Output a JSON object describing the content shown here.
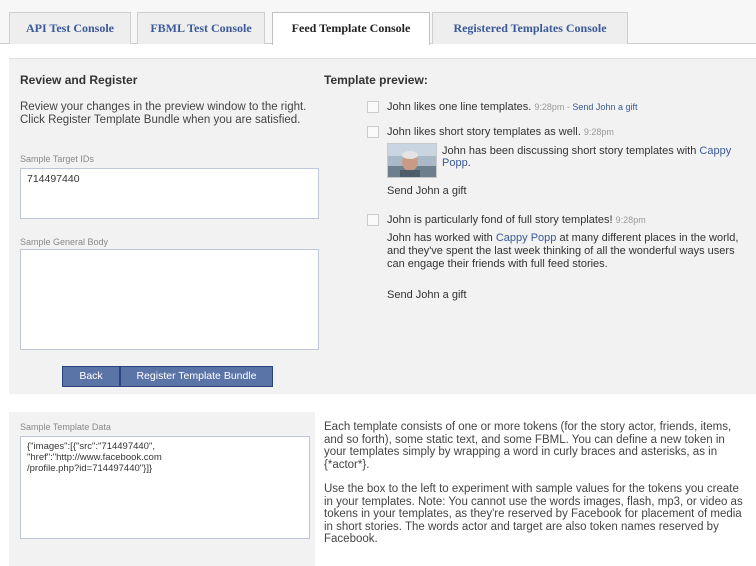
{
  "tabs": [
    {
      "label": "API Test Console"
    },
    {
      "label": "FBML Test Console"
    },
    {
      "label": "Feed Template Console"
    },
    {
      "label": "Registered Templates Console"
    }
  ],
  "review": {
    "heading": "Review and Register",
    "description": "Review your changes in the preview window to the right. Click Register Template Bundle when you are satisfied.",
    "target_ids_label": "Sample Target IDs",
    "target_ids_value": "714497440",
    "general_body_label": "Sample General Body",
    "general_body_value": "",
    "back_button": "Back",
    "register_button": "Register Template Bundle"
  },
  "preview": {
    "heading": "Template preview:",
    "one_line": {
      "text": "John likes one line templates.",
      "time": "9:28pm",
      "separator": " - ",
      "gift": "Send John a gift"
    },
    "short_story": {
      "title": "John likes short story templates as well.",
      "time": "9:28pm",
      "body_prefix": "John has been discussing short story templates with ",
      "body_link": "Cappy Popp",
      "body_suffix": ".",
      "gift": "Send John a gift"
    },
    "full_story": {
      "title": "John is particularly fond of full story templates!",
      "time": "9:28pm",
      "body_prefix": "John has worked with ",
      "body_link": "Cappy Popp",
      "body_suffix": " at many different places in the world, and they've spent the last week thinking of all the wonderful ways users can engage their friends with full feed stories.",
      "gift": "Send John a gift"
    }
  },
  "template_data": {
    "label": "Sample Template Data",
    "value": "{\"images\":[{\"src\":\"714497440\",\n\"href\":\"http://www.facebook.com\n/profile.php?id=714497440\"}]}"
  },
  "info": {
    "paragraph1": "Each template consists of one or more tokens (for the story actor, friends, items, and so forth), some static text, and some FBML. You can define a new token in your templates simply by wrapping a word in curly braces and asterisks, as in {*actor*}.",
    "paragraph2": "Use the box to the left to experiment with sample values for the tokens you create in your templates. Note: You cannot use the words images, flash, mp3, or video as tokens in your templates, as they're reserved by Facebook for placement of media in short stories. The words actor and target are also token names reserved by Facebook."
  },
  "colors": {
    "link": "#3b5998",
    "button": "#5b74a8",
    "panel": "#f2f2f2"
  }
}
